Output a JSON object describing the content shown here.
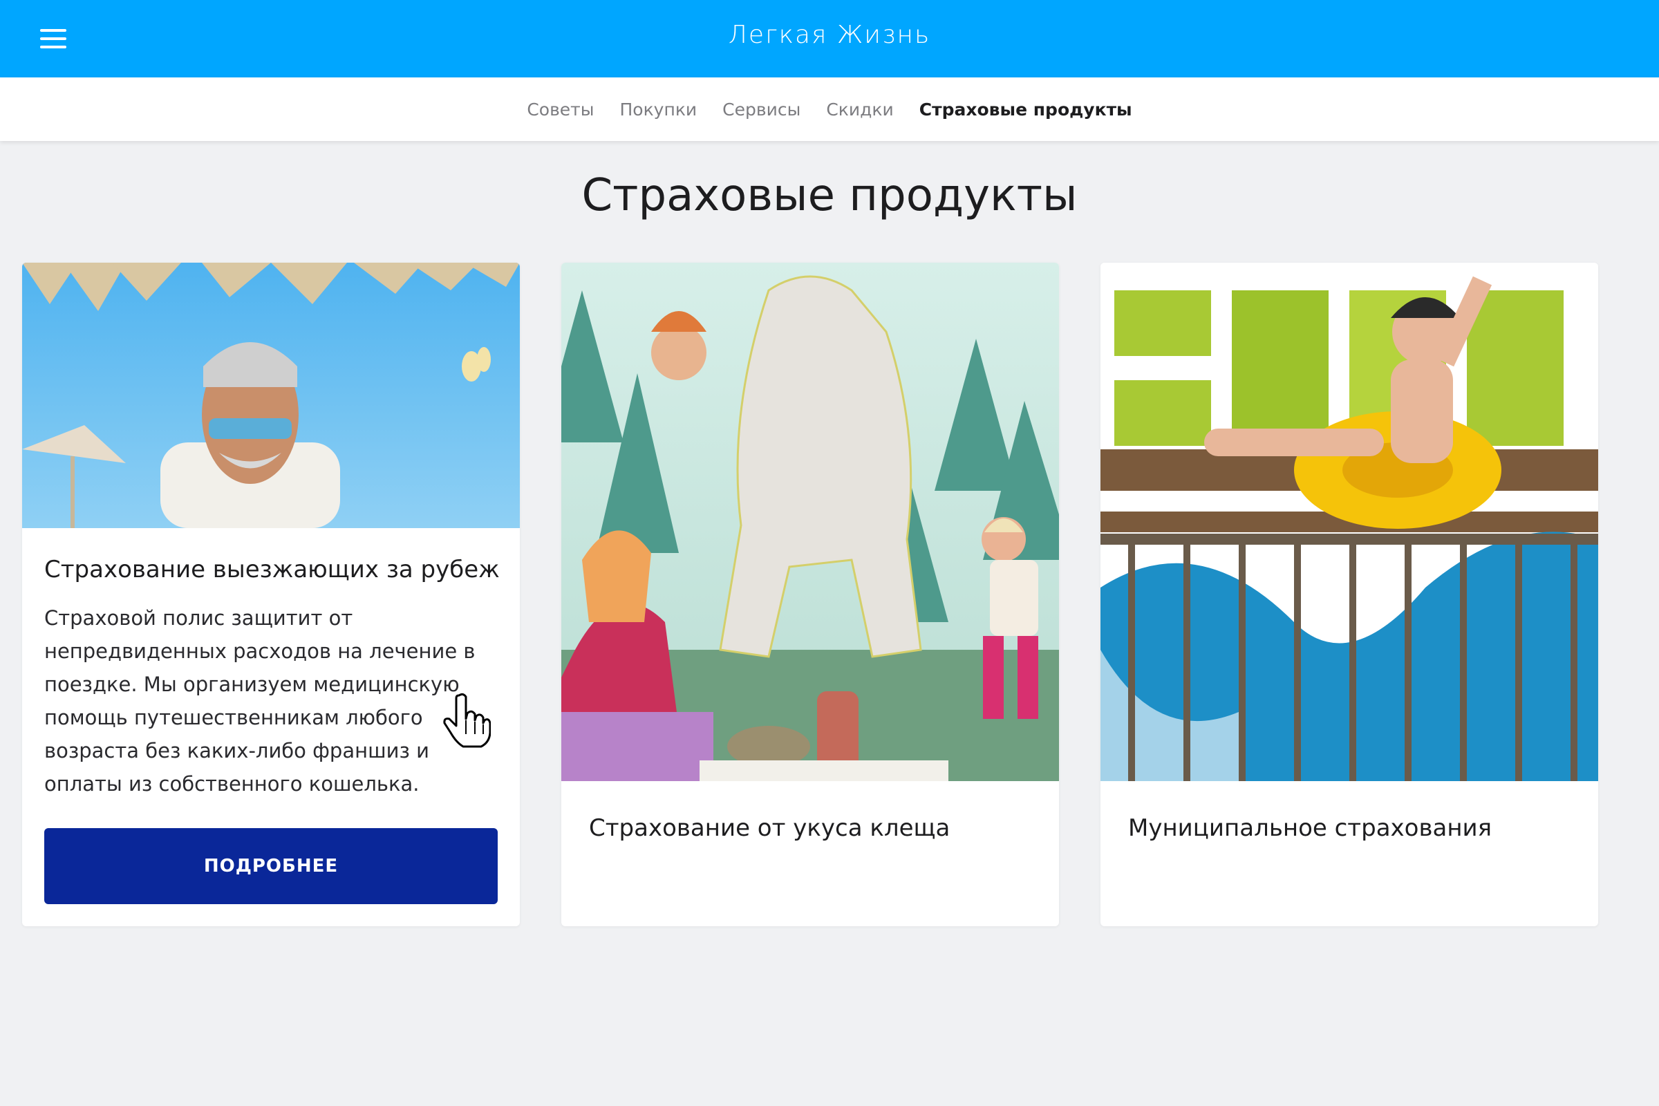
{
  "header": {
    "title": "Легкая Жизнь",
    "menu_icon": "hamburger-menu-icon"
  },
  "nav": {
    "items": [
      {
        "label": "Советы",
        "active": false
      },
      {
        "label": "Покупки",
        "active": false
      },
      {
        "label": "Сервисы",
        "active": false
      },
      {
        "label": "Скидки",
        "active": false
      },
      {
        "label": "Страховые продукты",
        "active": true
      }
    ]
  },
  "page": {
    "title": "Страховые продукты"
  },
  "cards": [
    {
      "title": "Страхование выезжающих за рубеж",
      "text": "Страховой полис защитит от непредвиденных расходов на лечение в поездке. Мы организуем медицинскую помощь путешественникам любого возраста без каких-либо франшиз и оплаты из собственного кошелька.",
      "button": "ПОДРОБНЕЕ"
    },
    {
      "title": "Страхование от укуса клеща"
    },
    {
      "title": "Муниципальное страхования"
    }
  ],
  "colors": {
    "header_bg": "#00a6ff",
    "button_bg": "#0a2799",
    "page_bg": "#f0f1f3"
  }
}
